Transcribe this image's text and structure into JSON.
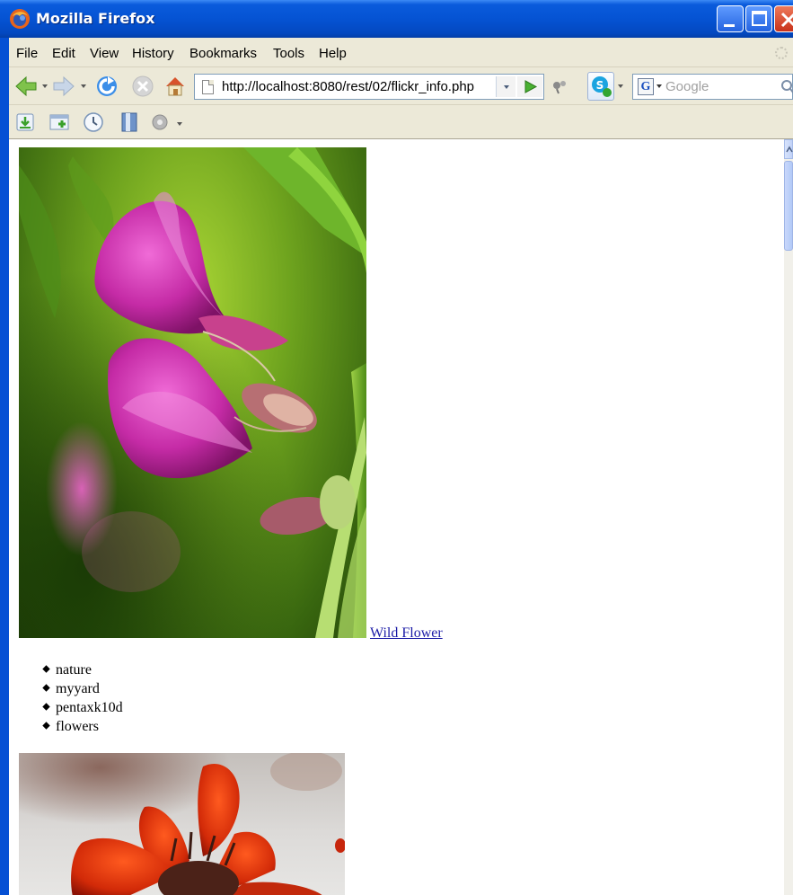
{
  "window": {
    "title": "Mozilla Firefox",
    "title_bar_color": "#0553d3",
    "buttons": [
      "minimize-icon",
      "maximize-icon",
      "close-icon"
    ]
  },
  "menubar": {
    "items": [
      "File",
      "Edit",
      "View",
      "History",
      "Bookmarks",
      "Tools",
      "Help"
    ]
  },
  "navbar": {
    "icons": [
      "back-icon",
      "forward-icon",
      "reload-icon",
      "stop-icon",
      "home-icon",
      "go-icon",
      "addon-icon",
      "skype-icon"
    ],
    "url": "http://localhost:8080/rest/02/flickr_info.php",
    "search_placeholder": "Google",
    "search_engine_icon": "google-icon"
  },
  "bookmarks_bar": {
    "icons": [
      "download-icon",
      "new-tab-icon",
      "history-clock-icon",
      "bookmarks-book-icon",
      "media-disc-icon"
    ]
  },
  "content": {
    "photos": [
      {
        "link_text": "Wild Flower",
        "tags": [
          "nature",
          "myyard",
          "pentaxk10d",
          "flowers"
        ],
        "subject": "pink-sweet-pea-flower"
      },
      {
        "subject": "red-orange-flower"
      }
    ],
    "link_color": "#1a1aa6"
  }
}
